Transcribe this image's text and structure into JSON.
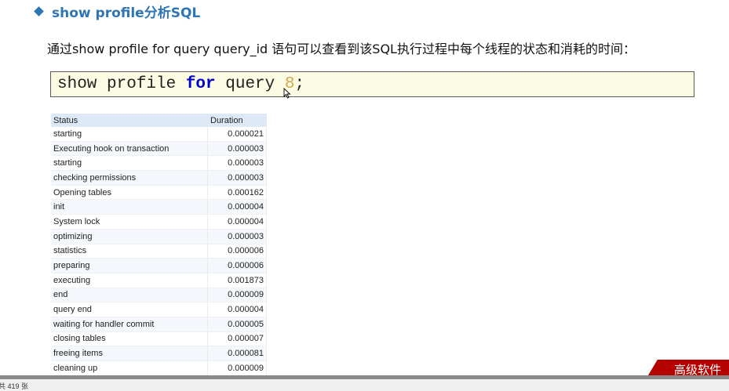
{
  "heading": {
    "title": "show profile分析SQL"
  },
  "description": "通过show  profile for  query  query_id 语句可以查看到该SQL执行过程中每个线程的状态和消耗的时间：",
  "code": {
    "part1": "show profile ",
    "keyword": "for",
    "part2": " query ",
    "number": "8",
    "end": ";"
  },
  "table": {
    "headers": {
      "status": "Status",
      "duration": "Duration"
    },
    "rows": [
      {
        "status": "starting",
        "duration": "0.000021"
      },
      {
        "status": "Executing hook on transaction",
        "duration": "0.000003"
      },
      {
        "status": "starting",
        "duration": "0.000003"
      },
      {
        "status": "checking permissions",
        "duration": "0.000003"
      },
      {
        "status": "Opening tables",
        "duration": "0.000162"
      },
      {
        "status": "init",
        "duration": "0.000004"
      },
      {
        "status": "System lock",
        "duration": "0.000004"
      },
      {
        "status": "optimizing",
        "duration": "0.000003"
      },
      {
        "status": "statistics",
        "duration": "0.000006"
      },
      {
        "status": "preparing",
        "duration": "0.000006"
      },
      {
        "status": "executing",
        "duration": "0.001873"
      },
      {
        "status": "end",
        "duration": "0.000009"
      },
      {
        "status": "query end",
        "duration": "0.000004"
      },
      {
        "status": "waiting for handler commit",
        "duration": "0.000005"
      },
      {
        "status": "closing tables",
        "duration": "0.000007"
      },
      {
        "status": "freeing items",
        "duration": "0.000081"
      },
      {
        "status": "cleaning up",
        "duration": "0.000009"
      }
    ]
  },
  "statusbar": {
    "count": "共 419 张"
  },
  "banner": {
    "text": "高级软件"
  },
  "colors": {
    "accent": "#2e75b6",
    "keyword": "#0000cc",
    "number": "#d4a84c",
    "banner": "#b50000"
  }
}
